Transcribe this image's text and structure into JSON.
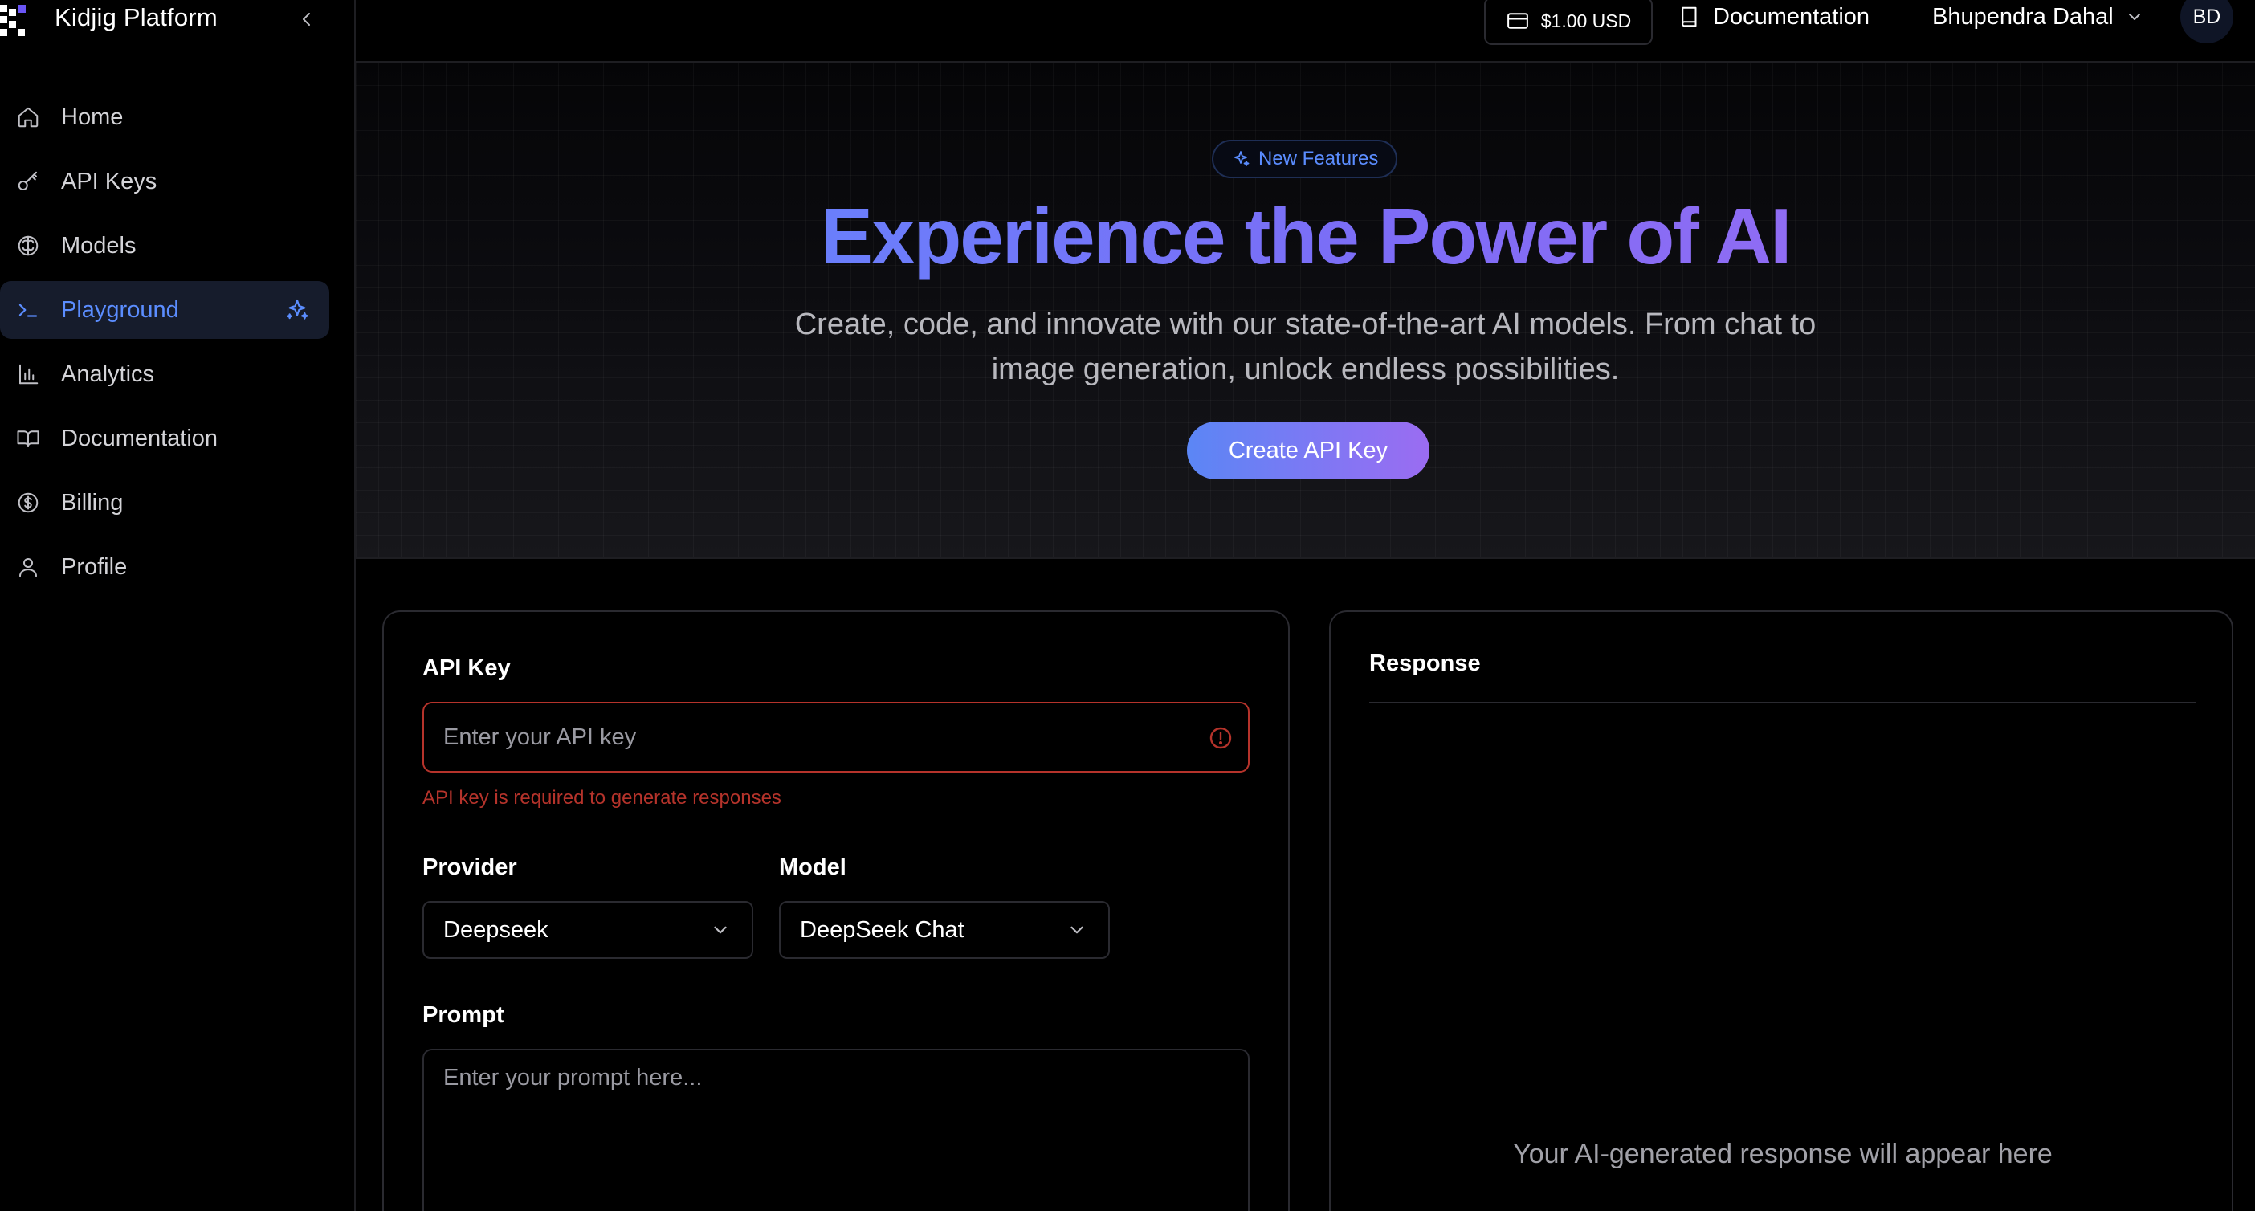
{
  "brand": {
    "name": "Kidjig Platform"
  },
  "sidebar": {
    "items": [
      {
        "label": "Home",
        "icon": "home-icon"
      },
      {
        "label": "API Keys",
        "icon": "key-icon"
      },
      {
        "label": "Models",
        "icon": "brain-icon"
      },
      {
        "label": "Playground",
        "icon": "terminal-icon",
        "active": true
      },
      {
        "label": "Analytics",
        "icon": "bar-chart-icon"
      },
      {
        "label": "Documentation",
        "icon": "book-icon"
      },
      {
        "label": "Billing",
        "icon": "dollar-circle-icon"
      },
      {
        "label": "Profile",
        "icon": "user-icon"
      }
    ]
  },
  "header": {
    "balance": "$1.00 USD",
    "documentation": "Documentation",
    "user_name": "Bhupendra Dahal",
    "avatar_initials": "BD"
  },
  "hero": {
    "badge": "New Features",
    "title": "Experience the Power of AI",
    "subtitle": "Create, code, and innovate with our state-of-the-art AI models. From chat to image generation, unlock endless possibilities.",
    "cta": "Create API Key"
  },
  "form": {
    "api_key_label": "API Key",
    "api_key_placeholder": "Enter your API key",
    "api_key_error": "API key is required to generate responses",
    "provider_label": "Provider",
    "provider_value": "Deepseek",
    "model_label": "Model",
    "model_value": "DeepSeek Chat",
    "prompt_label": "Prompt",
    "prompt_placeholder": "Enter your prompt here..."
  },
  "response": {
    "title": "Response",
    "placeholder": "Your AI-generated response will appear here"
  },
  "colors": {
    "accent": "#5b8dff",
    "gradient_end": "#a56bf0",
    "error": "#b5332b",
    "background": "#000000"
  }
}
